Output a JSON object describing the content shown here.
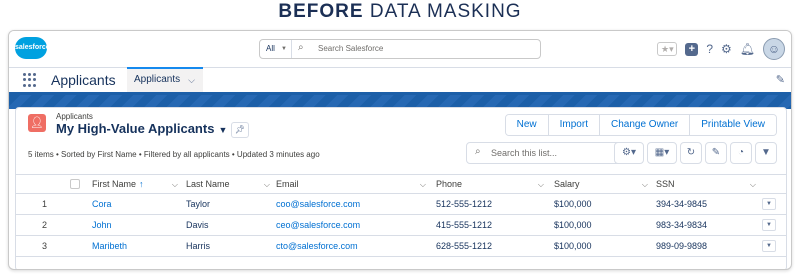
{
  "page_heading": {
    "bold": "BEFORE",
    "light": "DATA MASKING"
  },
  "global_header": {
    "logo_text": "salesforce",
    "search_scope": "All",
    "search_placeholder": "Search Salesforce"
  },
  "app_nav": {
    "app_name": "Applicants",
    "tab_label": "Applicants"
  },
  "list_view": {
    "object_label": "Applicants",
    "view_name": "My High-Value Applicants",
    "meta": "5 items • Sorted by First Name • Filtered by all applicants • Updated 3 minutes ago",
    "search_placeholder": "Search this list...",
    "buttons": [
      "New",
      "Import",
      "Change Owner",
      "Printable View"
    ],
    "columns": [
      "First Name",
      "Last Name",
      "Email",
      "Phone",
      "Salary",
      "SSN"
    ],
    "rows": [
      {
        "num": "1",
        "first": "Cora",
        "last": "Taylor",
        "email": "coo@salesforce.com",
        "phone": "512-555-1212",
        "salary": "$100,000",
        "ssn": "394-34-9845"
      },
      {
        "num": "2",
        "first": "John",
        "last": "Davis",
        "email": "ceo@salesforce.com",
        "phone": "415-555-1212",
        "salary": "$100,000",
        "ssn": "983-34-9834"
      },
      {
        "num": "3",
        "first": "Maribeth",
        "last": "Harris",
        "email": "cto@salesforce.com",
        "phone": "628-555-1212",
        "salary": "$100,000",
        "ssn": "989-09-9898"
      }
    ]
  },
  "colors": {
    "brand_blue": "#0070d2",
    "header_band": "#1c5fa8",
    "list_icon": "#ef6e64"
  }
}
